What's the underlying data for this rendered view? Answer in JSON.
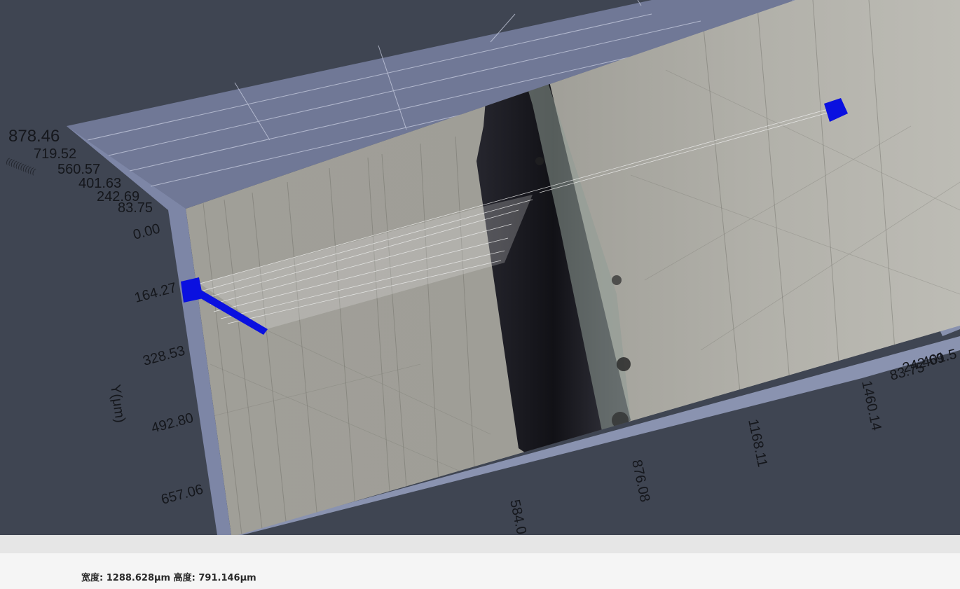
{
  "viewer": {
    "z_axis": {
      "ticks": [
        "878.46",
        "719.52",
        "560.57",
        "401.63",
        "242.69",
        "83.75"
      ]
    },
    "y_axis": {
      "label": "Y(μm)",
      "ticks": [
        "0.00",
        "164.27",
        "328.53",
        "492.80",
        "657.06"
      ]
    },
    "x_axis": {
      "ticks": [
        "584.0",
        "876.08",
        "1168.11",
        "1460.14"
      ]
    },
    "corner_labels": [
      "242.69",
      "83.75",
      "401.5"
    ],
    "colors": {
      "background": "#3f4552",
      "frame": "#8a93b0",
      "surface": "#a8a8a2",
      "groove": "#1a1a22",
      "marker": "#0a10e0"
    },
    "markers": [
      "cursor-marker-left",
      "cursor-marker-right"
    ]
  },
  "status": {
    "width_label": "宽度:",
    "width_value": "1288.628μm",
    "height_label": "高度:",
    "height_value": "791.146μm"
  }
}
